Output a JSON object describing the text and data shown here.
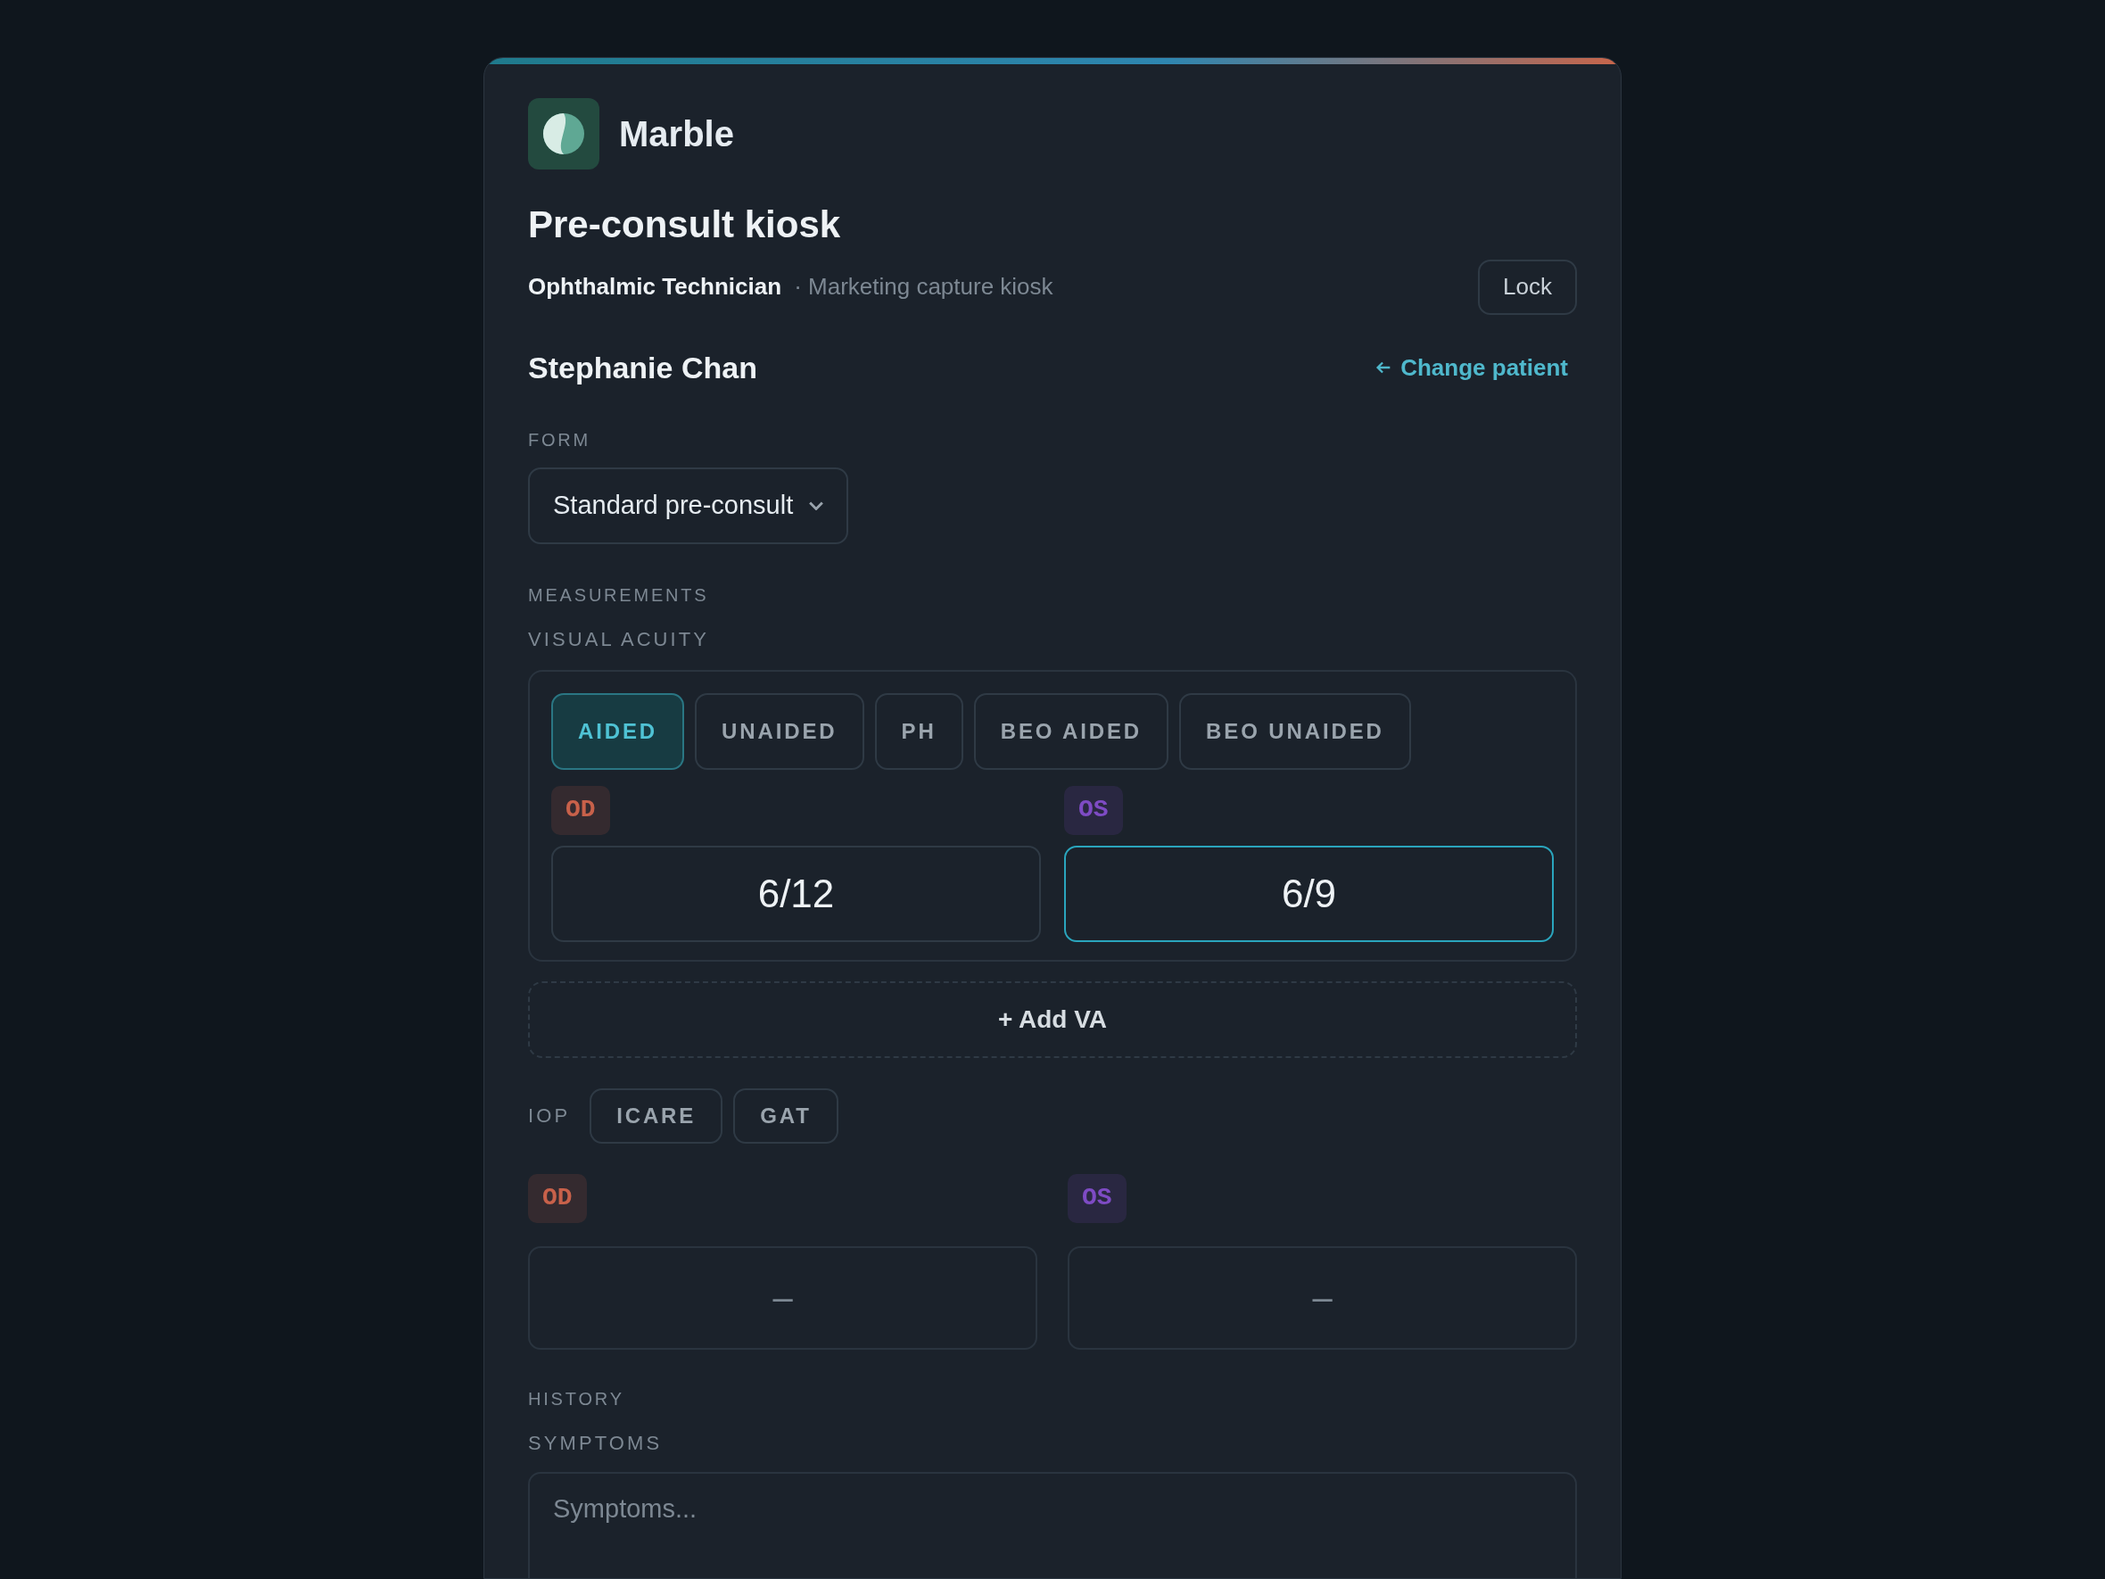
{
  "brand": {
    "name": "Marble"
  },
  "title": "Pre-consult kiosk",
  "role": "Ophthalmic Technician",
  "context": "· Marketing capture kiosk",
  "lock_button": "Lock",
  "patient": {
    "name": "Stephanie Chan",
    "change_link": "Change patient"
  },
  "form": {
    "label": "FORM",
    "value": "Standard pre-consult"
  },
  "measurements": {
    "label": "MEASUREMENTS",
    "visual_acuity": {
      "label": "VISUAL ACUITY",
      "tabs": [
        {
          "label": "AIDED",
          "selected": true
        },
        {
          "label": "UNAIDED",
          "selected": false
        },
        {
          "label": "PH",
          "selected": false
        },
        {
          "label": "BEO AIDED",
          "selected": false
        },
        {
          "label": "BEO UNAIDED",
          "selected": false
        }
      ],
      "eyes": [
        {
          "tag": "OD",
          "color": "#c8614a",
          "value": "6/12",
          "focused": false
        },
        {
          "tag": "OS",
          "color": "#7e4bc4",
          "value": "6/9",
          "focused": true
        }
      ],
      "add_button": "+ Add VA"
    },
    "iop": {
      "label": "IOP",
      "methods": [
        {
          "label": "ICARE",
          "selected": false
        },
        {
          "label": "GAT",
          "selected": false
        }
      ],
      "eyes": [
        {
          "tag": "OD",
          "color": "#c8614a",
          "placeholder": "–"
        },
        {
          "tag": "OS",
          "color": "#7e4bc4",
          "placeholder": "–"
        }
      ]
    }
  },
  "history": {
    "label": "HISTORY",
    "symptoms": {
      "label": "SYMPTOMS",
      "placeholder": "Symptoms..."
    }
  }
}
